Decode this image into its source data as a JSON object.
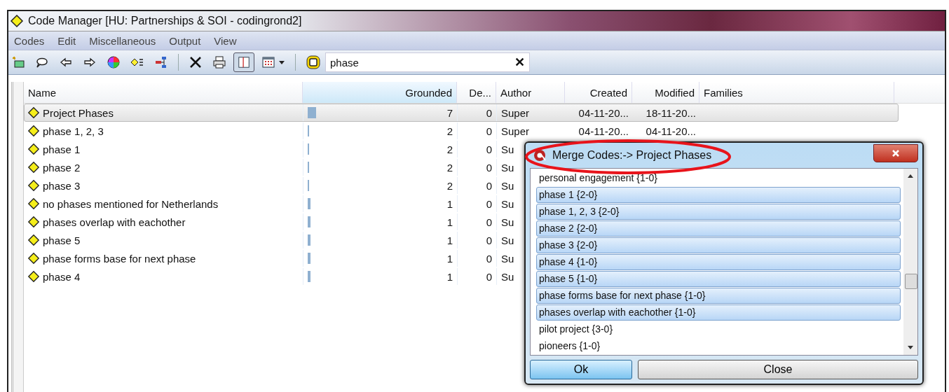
{
  "window": {
    "title": "Code Manager [HU: Partnerships & SOI - codingrond2]"
  },
  "menu": [
    "Codes",
    "Edit",
    "Miscellaneous",
    "Output",
    "View"
  ],
  "search": {
    "value": "phase",
    "clear": "✕"
  },
  "table": {
    "columns": [
      "Name",
      "Grounded",
      "De...",
      "Author",
      "Created",
      "Modified",
      "Families"
    ],
    "rows": [
      {
        "name": "Project Phases",
        "grounded": "7",
        "density": "0",
        "author": "Super",
        "created": "04-11-20...",
        "modified": "18-11-20...",
        "level": 0.06,
        "selected": true
      },
      {
        "name": "phase 1, 2, 3",
        "grounded": "2",
        "density": "0",
        "author": "Super",
        "created": "04-11-20...",
        "modified": "04-11-20...",
        "level": 0.01,
        "selected": false
      },
      {
        "name": "phase 1",
        "grounded": "2",
        "density": "0",
        "author": "Su",
        "level": 0.01,
        "selected": false
      },
      {
        "name": "phase 2",
        "grounded": "2",
        "density": "0",
        "author": "Su",
        "level": 0.01,
        "selected": false
      },
      {
        "name": "phase 3",
        "grounded": "2",
        "density": "0",
        "author": "Su",
        "level": 0.01,
        "selected": false
      },
      {
        "name": "no phases mentioned for Netherlands",
        "grounded": "1",
        "density": "0",
        "author": "Su",
        "level": 0.02,
        "selected": false
      },
      {
        "name": "phases overlap with eachother",
        "grounded": "1",
        "density": "0",
        "author": "Su",
        "level": 0.02,
        "selected": false
      },
      {
        "name": "phase 5",
        "grounded": "1",
        "density": "0",
        "author": "Su",
        "level": 0.02,
        "selected": false
      },
      {
        "name": "phase forms base for next phase",
        "grounded": "1",
        "density": "0",
        "author": "Su",
        "level": 0.02,
        "selected": false
      },
      {
        "name": "phase 4",
        "grounded": "1",
        "density": "0",
        "author": "Su",
        "level": 0.02,
        "selected": false
      }
    ]
  },
  "dialog": {
    "title": "Merge Codes:-> Project Phases",
    "items": [
      {
        "label": "personal engagement {1-0}",
        "selected": false
      },
      {
        "label": "phase 1 {2-0}",
        "selected": true
      },
      {
        "label": "phase 1, 2, 3 {2-0}",
        "selected": true
      },
      {
        "label": "phase 2 {2-0}",
        "selected": true
      },
      {
        "label": "phase 3 {2-0}",
        "selected": true
      },
      {
        "label": "phase 4 {1-0}",
        "selected": true
      },
      {
        "label": "phase 5 {1-0}",
        "selected": true
      },
      {
        "label": "phase forms base for next phase {1-0}",
        "selected": true
      },
      {
        "label": "phases overlap with eachother {1-0}",
        "selected": true
      },
      {
        "label": "pilot project {3-0}",
        "selected": false
      },
      {
        "label": "pioneers {1-0}",
        "selected": false
      }
    ],
    "buttons": [
      "Ok",
      "Close"
    ]
  }
}
